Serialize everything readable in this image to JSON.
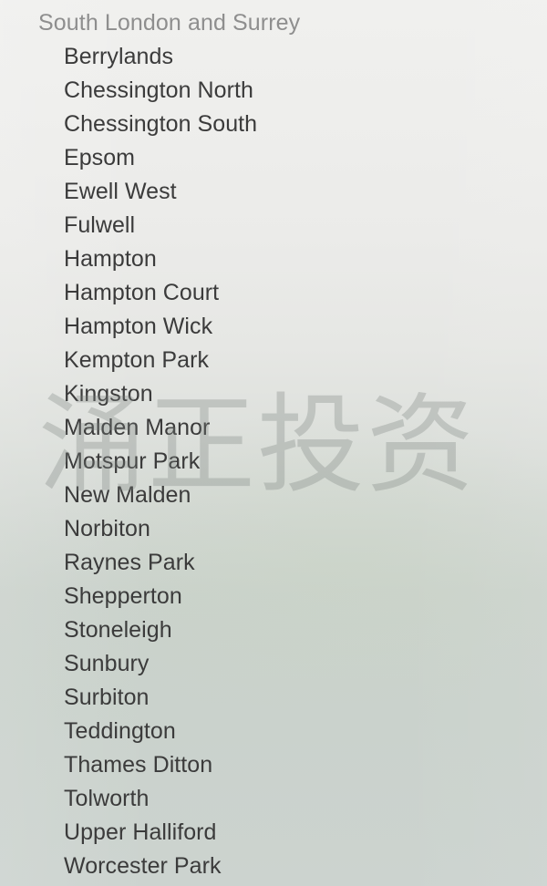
{
  "group": {
    "header": "South London and Surrey"
  },
  "stations": [
    {
      "name": "Berrylands"
    },
    {
      "name": "Chessington North"
    },
    {
      "name": "Chessington South"
    },
    {
      "name": "Epsom"
    },
    {
      "name": "Ewell West"
    },
    {
      "name": "Fulwell"
    },
    {
      "name": "Hampton"
    },
    {
      "name": "Hampton Court"
    },
    {
      "name": "Hampton Wick"
    },
    {
      "name": "Kempton Park"
    },
    {
      "name": "Kingston"
    },
    {
      "name": "Malden Manor"
    },
    {
      "name": "Motspur Park"
    },
    {
      "name": "New Malden"
    },
    {
      "name": "Norbiton"
    },
    {
      "name": "Raynes Park"
    },
    {
      "name": "Shepperton"
    },
    {
      "name": "Stoneleigh"
    },
    {
      "name": "Sunbury"
    },
    {
      "name": "Surbiton"
    },
    {
      "name": "Teddington"
    },
    {
      "name": "Thames Ditton"
    },
    {
      "name": "Tolworth"
    },
    {
      "name": "Upper Halliford"
    },
    {
      "name": "Worcester Park"
    }
  ],
  "watermark": {
    "text": "涌正投资"
  },
  "colors": {
    "header_text": "#8e8e8e",
    "item_text": "#3b3b3b",
    "background_top": "#f0f0ee",
    "background_bottom": "#ccd3cf",
    "watermark": "#787e7a"
  }
}
